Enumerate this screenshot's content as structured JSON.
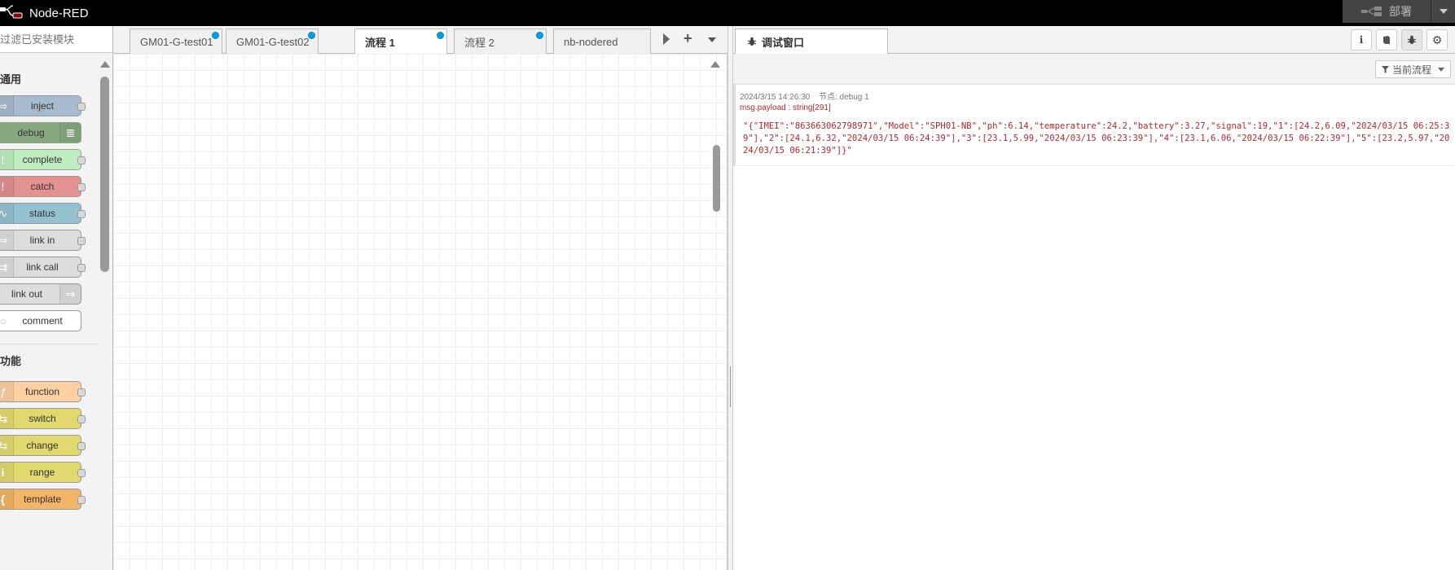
{
  "app": {
    "title": "Node-RED"
  },
  "header": {
    "deploy_label": "部署"
  },
  "palette": {
    "search_placeholder": "过滤已安装模块",
    "categories": [
      {
        "label": "通用",
        "nodes": [
          {
            "label": "inject",
            "color": "#a6bbcf",
            "icon": "arrow-icon"
          },
          {
            "label": "debug",
            "color": "#87a980",
            "icon": "list-icon"
          },
          {
            "label": "complete",
            "color": "#c0edc0",
            "icon": "exclamation-icon"
          },
          {
            "label": "catch",
            "color": "#e49191",
            "icon": "exclamation-icon"
          },
          {
            "label": "status",
            "color": "#94c1d0",
            "icon": "pulse-icon"
          },
          {
            "label": "link in",
            "color": "#dddddd",
            "icon": "link-icon"
          },
          {
            "label": "link call",
            "color": "#dddddd",
            "icon": "link-icon"
          },
          {
            "label": "link out",
            "color": "#dddddd",
            "icon": "link-icon"
          },
          {
            "label": "comment",
            "color": "#ffffff",
            "icon": "comment-icon"
          }
        ]
      },
      {
        "label": "功能",
        "nodes": [
          {
            "label": "function",
            "color": "#fdd0a2",
            "icon": "function-icon"
          },
          {
            "label": "switch",
            "color": "#e2d96e",
            "icon": "switch-icon"
          },
          {
            "label": "change",
            "color": "#e2d96e",
            "icon": "change-icon"
          },
          {
            "label": "range",
            "color": "#e2d96e",
            "icon": "range-icon"
          },
          {
            "label": "template",
            "color": "#f3b567",
            "icon": "template-icon"
          }
        ]
      }
    ]
  },
  "workspace": {
    "tabs": [
      {
        "label": "GM01-G-test01",
        "changed": true
      },
      {
        "label": "GM01-G-test02",
        "changed": true
      },
      {
        "label": "流程 1",
        "changed": true,
        "active": true
      },
      {
        "label": "流程 2",
        "changed": true
      },
      {
        "label": "nb-nodered",
        "changed": false
      }
    ]
  },
  "sidebar": {
    "tab_label": "调试窗口",
    "filter_label": "当前流程",
    "message": {
      "timestamp": "2024/3/15 14:26:30",
      "node": "节点: debug 1",
      "topic": "msg.payload : string[291]",
      "payload": "\"{\"IMEI\":\"863663062798971\",\"Model\":\"SPH01-NB\",\"ph\":6.14,\"temperature\":24.2,\"battery\":3.27,\"signal\":19,\"1\":[24.2,6.09,\"2024/03/15 06:25:39\"],\"2\":[24.1,6.32,\"2024/03/15 06:24:39\"],\"3\":[23.1,5.99,\"2024/03/15 06:23:39\"],\"4\":[23.1,6.06,\"2024/03/15 06:22:39\"],\"5\":[23.2,5.97,\"2024/03/15 06:21:39\"]}\""
    }
  }
}
